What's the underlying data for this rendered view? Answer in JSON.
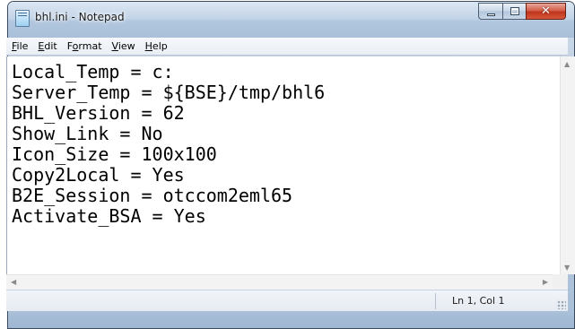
{
  "window": {
    "title": "bhl.ini - Notepad",
    "app_icon": "notepad-icon",
    "controls": {
      "minimize": "minimize-icon",
      "maximize": "maximize-icon",
      "close": "✕"
    }
  },
  "menu": {
    "items": [
      {
        "label": "File",
        "mnemonic": "F"
      },
      {
        "label": "Edit",
        "mnemonic": "E"
      },
      {
        "label": "Format",
        "mnemonic": "o"
      },
      {
        "label": "View",
        "mnemonic": "V"
      },
      {
        "label": "Help",
        "mnemonic": "H"
      }
    ]
  },
  "editor": {
    "lines": [
      "Local_Temp = c:",
      "Server_Temp = ${BSE}/tmp/bhl6",
      "BHL_Version = 62",
      "Show_Link = No",
      "Icon_Size = 100x100",
      "Copy2Local = Yes",
      "B2E_Session = otccom2eml65",
      "Activate_BSA = Yes"
    ]
  },
  "scrollbars": {
    "up": "▲",
    "down": "▼",
    "left": "◀",
    "right": "▶"
  },
  "status": {
    "position": "Ln 1, Col 1"
  },
  "colors": {
    "title_frame": "#b9cbe0",
    "close_button": "#c0341c",
    "editor_bg": "#ffffff"
  }
}
